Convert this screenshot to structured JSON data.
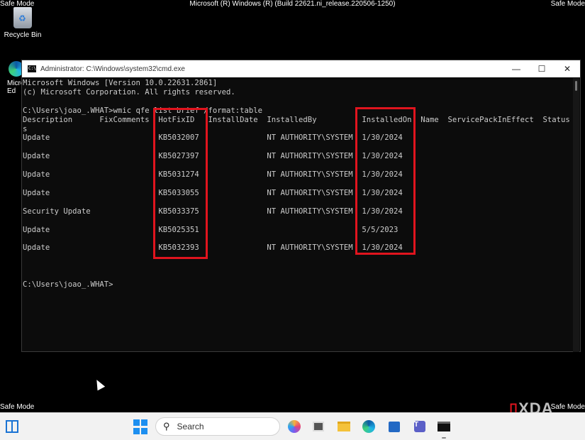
{
  "desktop": {
    "build_text": "Microsoft (R) Windows (R) (Build 22621.ni_release.220506-1250)",
    "safe_mode": "Safe Mode",
    "icons": [
      {
        "label": "Recycle Bin"
      },
      {
        "label": "Micro Ed"
      }
    ]
  },
  "window": {
    "title": "Administrator: C:\\Windows\\system32\\cmd.exe",
    "icon_text": "C:\\",
    "minimize": "—",
    "maximize": "☐",
    "close": "✕"
  },
  "console": {
    "lines": [
      "Microsoft Windows [Version 10.0.22631.2861]",
      "(c) Microsoft Corporation. All rights reserved.",
      "",
      "C:\\Users\\joao_.WHAT>wmic qfe list brief /format:table",
      "Description      FixComments  HotFixID   InstallDate  InstalledBy          InstalledOn  Name  ServicePackInEffect  Status",
      "s",
      "Update                        KB5032007               NT AUTHORITY\\SYSTEM  1/30/2024",
      "",
      "Update                        KB5027397               NT AUTHORITY\\SYSTEM  1/30/2024",
      "",
      "Update                        KB5031274               NT AUTHORITY\\SYSTEM  1/30/2024",
      "",
      "Update                        KB5033055               NT AUTHORITY\\SYSTEM  1/30/2024",
      "",
      "Security Update               KB5033375               NT AUTHORITY\\SYSTEM  1/30/2024",
      "",
      "Update                        KB5025351                                    5/5/2023",
      "",
      "Update                        KB5032393               NT AUTHORITY\\SYSTEM  1/30/2024",
      "",
      "",
      "",
      "C:\\Users\\joao_.WHAT>"
    ]
  },
  "watermark": {
    "bracket": "▯",
    "text": "XDA"
  },
  "taskbar": {
    "search_label": "Search",
    "search_icon": "magnifier-icon",
    "apps": [
      "copilot-icon",
      "terminal-icon",
      "file-explorer-icon",
      "edge-icon",
      "store-icon",
      "teams-icon",
      "cmd-icon"
    ]
  },
  "colors": {
    "highlight": "#e0141e",
    "console_bg": "#0c0c0c",
    "console_text": "#cccccc",
    "taskbar_bg": "#f2f2f2",
    "accent": "#1d8ff0"
  }
}
